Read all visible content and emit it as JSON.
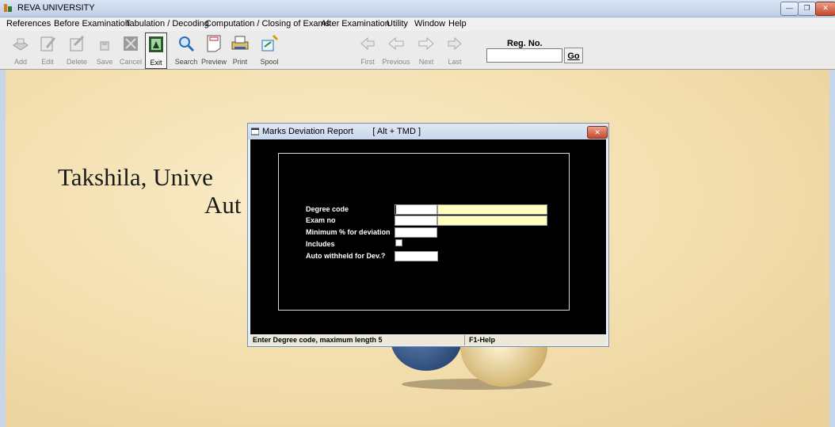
{
  "window": {
    "title": "REVA UNIVERSITY",
    "app_icon": "app-icon"
  },
  "menu": [
    "References",
    "Before Examination",
    "Tabulation / Decoding",
    "Computation / Closing of Exams",
    "After Examination",
    "Utility",
    "Window",
    "Help"
  ],
  "toolbar": {
    "buttons": [
      {
        "label": "Add",
        "icon": "add-icon"
      },
      {
        "label": "Edit",
        "icon": "edit-icon"
      },
      {
        "label": "Delete",
        "icon": "delete-icon"
      },
      {
        "label": "Save",
        "icon": "save-icon"
      },
      {
        "label": "Cancel",
        "icon": "cancel-icon"
      },
      {
        "label": "Exit",
        "icon": "exit-icon"
      },
      {
        "label": "Search",
        "icon": "search-icon"
      },
      {
        "label": "Preview",
        "icon": "preview-icon"
      },
      {
        "label": "Print",
        "icon": "print-icon"
      },
      {
        "label": "Spool",
        "icon": "spool-icon"
      },
      {
        "label": "First",
        "icon": "first-icon"
      },
      {
        "label": "Previous",
        "icon": "previous-icon"
      },
      {
        "label": "Next",
        "icon": "next-icon"
      },
      {
        "label": "Last",
        "icon": "last-icon"
      }
    ],
    "reg_no_label": "Reg. No.",
    "reg_no_value": "",
    "go_label": "Go"
  },
  "background": {
    "text_line1": "Takshila, Unive",
    "text_line2": "Aut"
  },
  "dialog": {
    "title": "Marks Deviation Report        [ Alt + TMD ]",
    "fields": {
      "degree_code": "Degree code",
      "exam_no": "Exam no",
      "min_pct": "Minimum % for deviation",
      "includes": "Includes",
      "auto_withheld": "Auto withheld for Dev.?"
    },
    "values": {
      "degree_code": "",
      "degree_desc": "",
      "exam_no": "",
      "exam_desc": "",
      "min_pct": "",
      "auto_withheld": ""
    },
    "status_message": "Enter Degree code, maximum length 5",
    "help_hint": "F1-Help"
  },
  "colors": {
    "dialog_body": "#000000",
    "desc_field": "#ffffc0",
    "title_bar": "#c9d7ec"
  }
}
